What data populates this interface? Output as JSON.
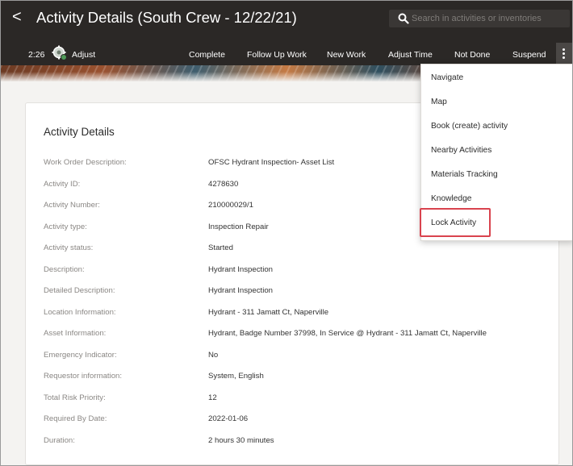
{
  "header": {
    "back_glyph": "<",
    "title": "Activity Details (South Crew - 12/22/21)",
    "search": {
      "placeholder": "Search in activities or inventories",
      "icon": "search-icon"
    }
  },
  "toolbar": {
    "time": "2:26",
    "adjust_label": "Adjust",
    "buttons": [
      "Complete",
      "Follow Up Work",
      "New Work",
      "Adjust Time",
      "Not Done",
      "Suspend"
    ]
  },
  "menu": {
    "items": [
      "Navigate",
      "Map",
      "Book (create) activity",
      "Nearby Activities",
      "Materials Tracking",
      "Knowledge",
      "Lock Activity"
    ],
    "highlighted_item": "Lock Activity",
    "highlight_color": "#d9434e"
  },
  "card": {
    "title": "Activity Details",
    "rows": [
      {
        "label": "Work Order Description:",
        "value": "OFSC Hydrant Inspection- Asset List"
      },
      {
        "label": "Activity ID:",
        "value": "4278630"
      },
      {
        "label": "Activity Number:",
        "value": "210000029/1"
      },
      {
        "label": "Activity type:",
        "value": "Inspection Repair"
      },
      {
        "label": "Activity status:",
        "value": "Started"
      },
      {
        "label": "Description:",
        "value": "Hydrant Inspection"
      },
      {
        "label": "Detailed Description:",
        "value": "Hydrant Inspection"
      },
      {
        "label": "Location Information:",
        "value": "Hydrant - 311 Jamatt Ct, Naperville"
      },
      {
        "label": "Asset Information:",
        "value": "Hydrant, Badge Number 37998, In Service @ Hydrant - 311 Jamatt Ct, Naperville"
      },
      {
        "label": "Emergency Indicator:",
        "value": "No"
      },
      {
        "label": "Requestor information:",
        "value": "System, English"
      },
      {
        "label": "Total Risk Priority:",
        "value": "12"
      },
      {
        "label": "Required By Date:",
        "value": "2022-01-06"
      },
      {
        "label": "Duration:",
        "value": "2 hours 30 minutes"
      }
    ]
  },
  "colors": {
    "header_bg": "#2b2826",
    "page_bg": "#f4f3f1",
    "card_bg": "#ffffff"
  }
}
